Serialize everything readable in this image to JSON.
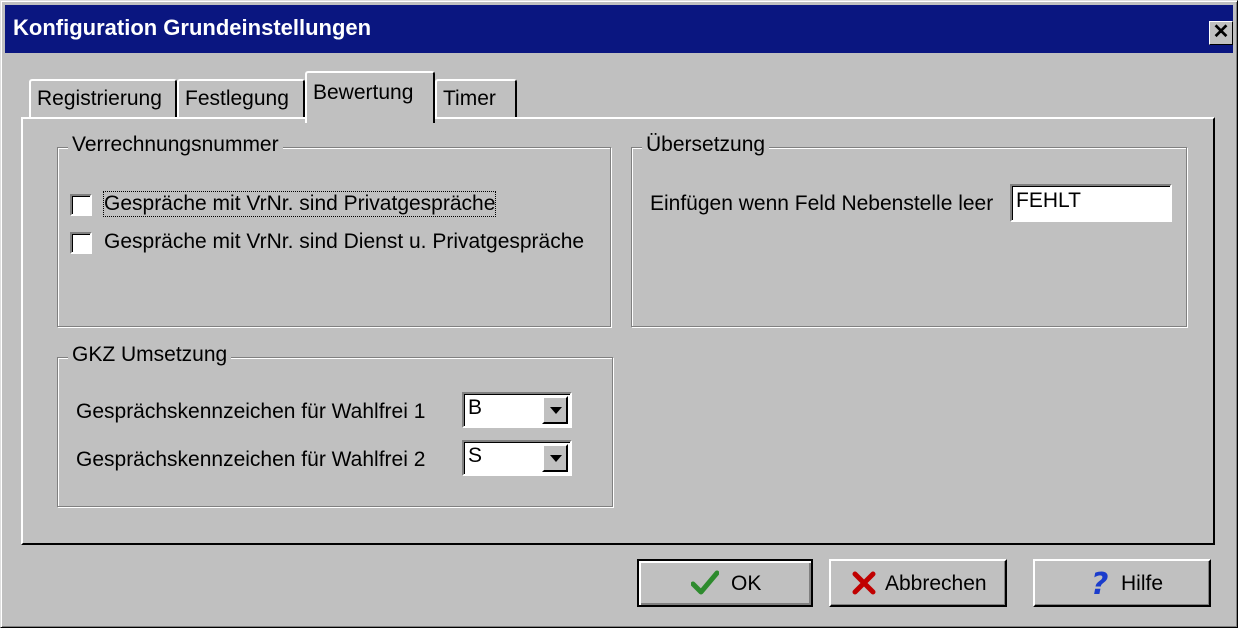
{
  "window": {
    "title": "Konfiguration Grundeinstellungen",
    "close_glyph": "✕"
  },
  "tabs": [
    {
      "label": "Registrierung",
      "active": false
    },
    {
      "label": "Festlegung",
      "active": false
    },
    {
      "label": "Bewertung",
      "active": true
    },
    {
      "label": "Timer",
      "active": false
    }
  ],
  "verrechnung": {
    "legend": "Verrechnungsnummer",
    "cb1_label": "Gespräche mit VrNr. sind Privatgespräche",
    "cb1_checked": false,
    "cb2_label": "Gespräche mit VrNr. sind Dienst u. Privatgespräche",
    "cb2_checked": false
  },
  "uebersetzung": {
    "legend": "Übersetzung",
    "field_label": "Einfügen wenn Feld Nebenstelle leer",
    "field_value": "FEHLT"
  },
  "gkz": {
    "legend": "GKZ Umsetzung",
    "row1_label": "Gesprächskennzeichen für Wahlfrei 1",
    "row1_value": "B",
    "row2_label": "Gesprächskennzeichen für Wahlfrei 2",
    "row2_value": "S"
  },
  "buttons": {
    "ok": "OK",
    "cancel": "Abbrechen",
    "help": "Hilfe"
  },
  "icons": {
    "ok": "checkmark-icon",
    "cancel": "x-icon",
    "help": "question-icon"
  },
  "colors": {
    "titlebar": "#0a1680",
    "face": "#c0c0c0",
    "ok_icon": "#2e8b2e",
    "cancel_icon": "#c00000",
    "help_icon": "#1a3ccc"
  }
}
